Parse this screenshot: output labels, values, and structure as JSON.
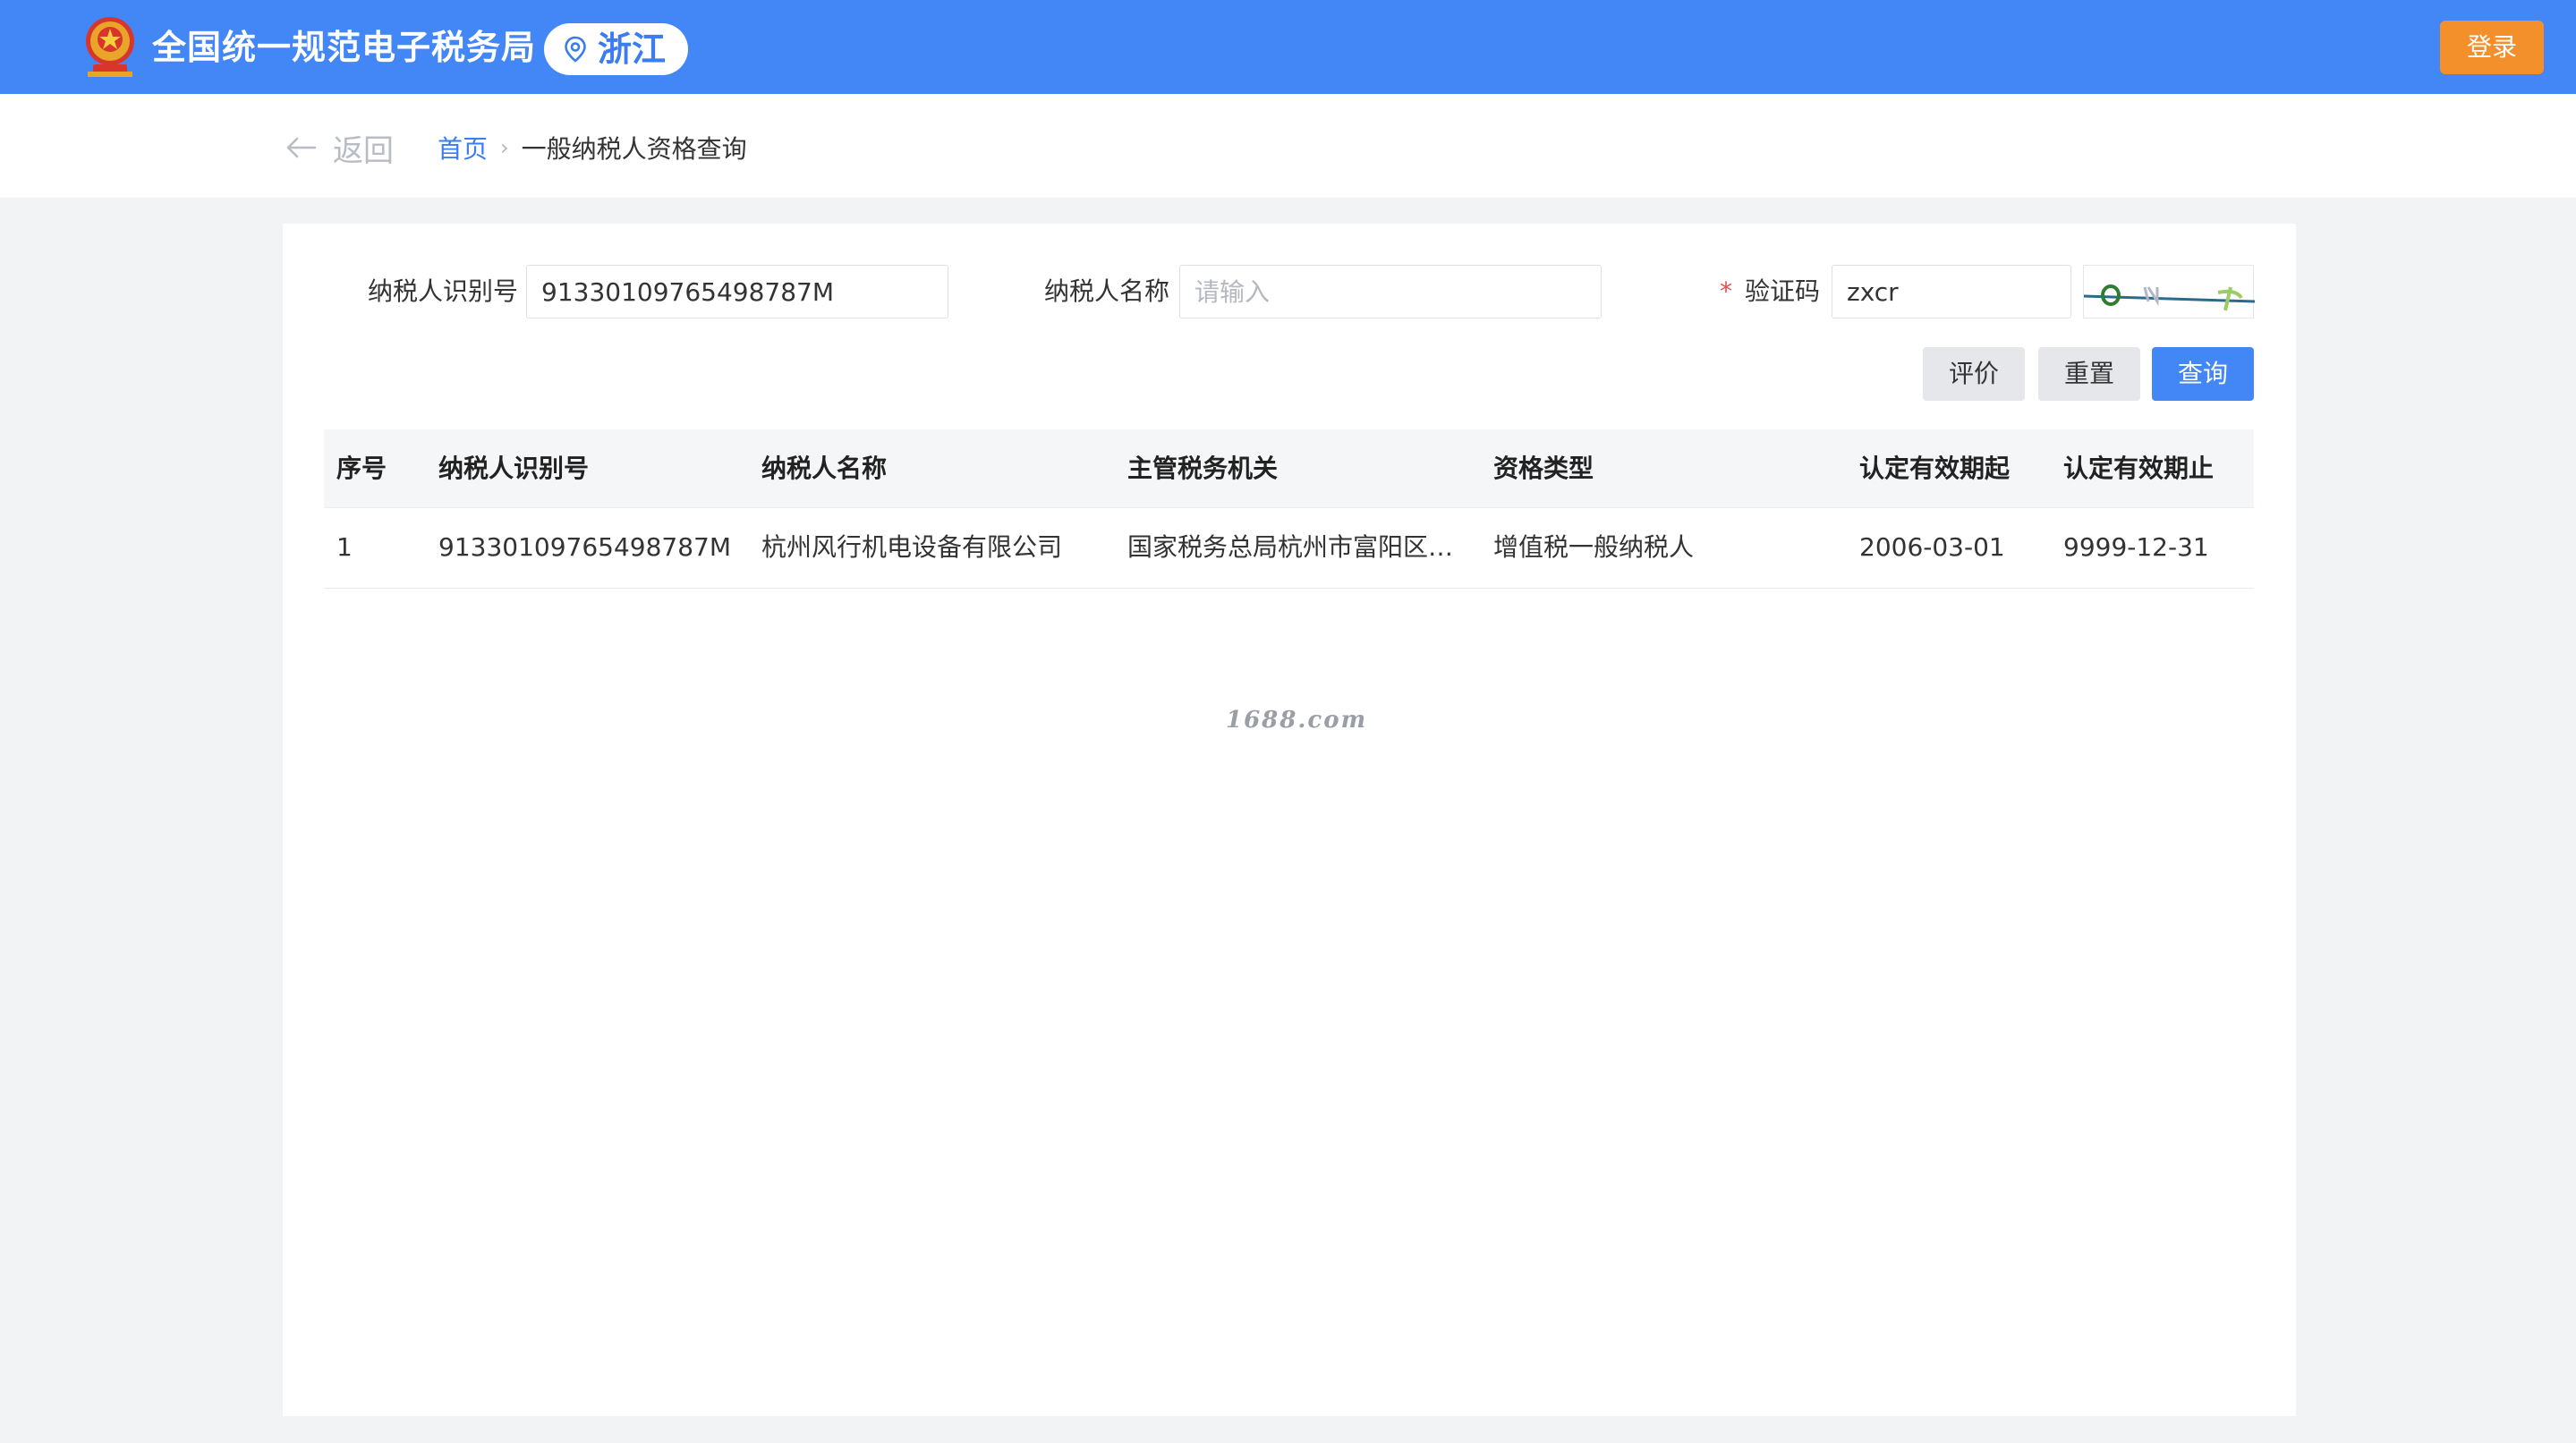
{
  "header": {
    "site_title": "全国统一规范电子税务局",
    "region": "浙江",
    "login_label": "登录",
    "brand_color": "#4386f5",
    "login_color": "#f4902b"
  },
  "breadcrumb": {
    "back_label": "返回",
    "home": "首页",
    "current": "一般纳税人资格查询"
  },
  "form": {
    "taxpayer_id_label": "纳税人识别号",
    "taxpayer_id_value": "91330109765498787M",
    "taxpayer_name_label": "纳税人名称",
    "taxpayer_name_placeholder": "请输入",
    "captcha_required_mark": "*",
    "captcha_label": "验证码",
    "captcha_value": "zxcr"
  },
  "actions": {
    "evaluate": "评价",
    "reset": "重置",
    "query": "查询"
  },
  "table": {
    "columns": [
      "序号",
      "纳税人识别号",
      "纳税人名称",
      "主管税务机关",
      "资格类型",
      "认定有效期起",
      "认定有效期止"
    ],
    "rows": [
      [
        "1",
        "91330109765498787M",
        "杭州风行机电设备有限公司",
        "国家税务总局杭州市富阳区税...",
        "增值税一般纳税人",
        "2006-03-01",
        "9999-12-31"
      ]
    ]
  },
  "watermark": "1688.com"
}
